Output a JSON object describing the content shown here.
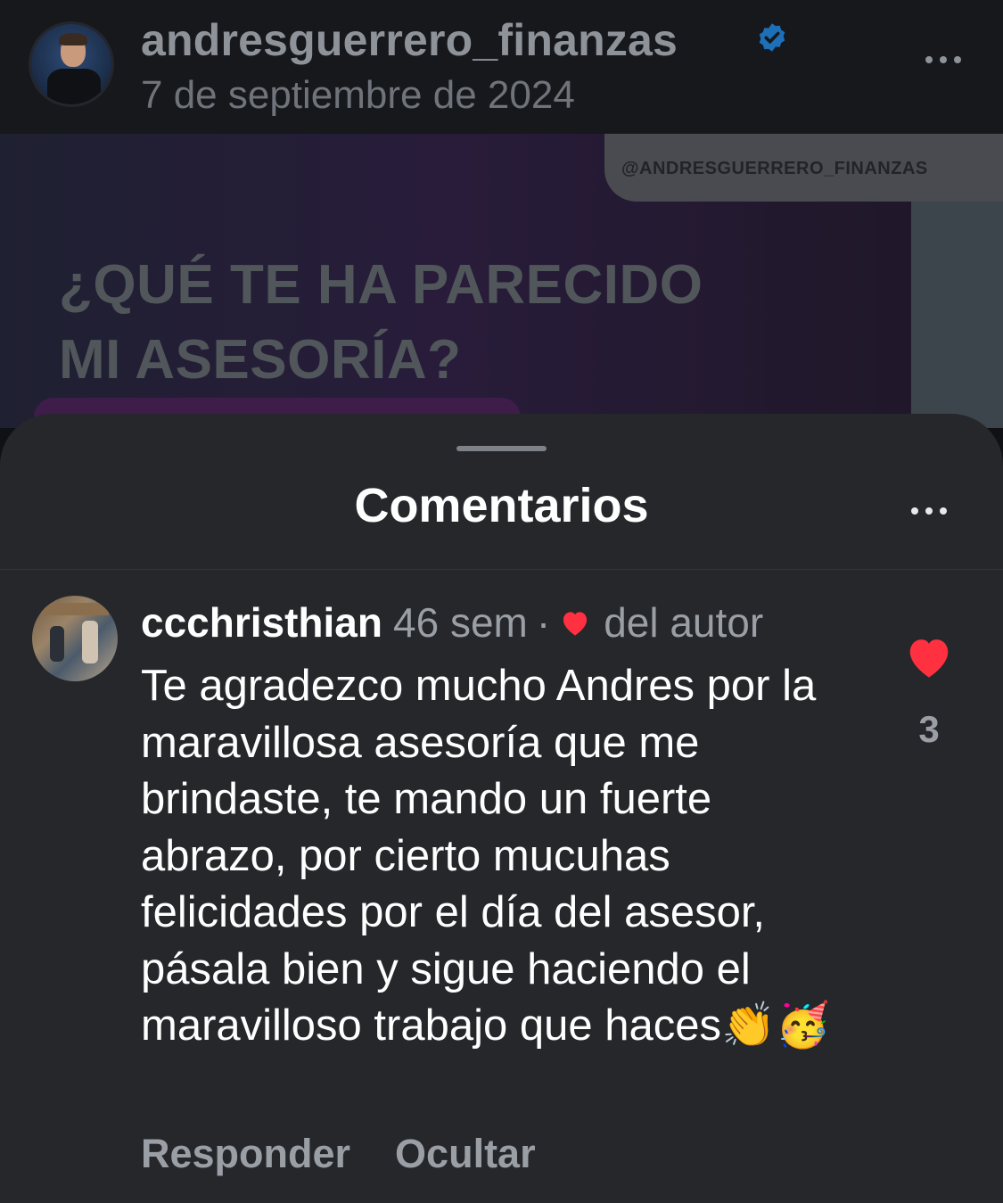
{
  "post": {
    "username": "andresguerrero_finanzas",
    "date": "7 de septiembre de 2024",
    "verified": true,
    "more_icon": "ellipsis-icon"
  },
  "post_image": {
    "handle": "@ANDRESGUERRERO_FINANZAS",
    "headline_line1": "¿QUÉ TE HA PARECIDO",
    "headline_line2": "MI ASESORÍA?"
  },
  "sheet": {
    "title": "Comentarios",
    "more_icon": "ellipsis-icon"
  },
  "comment": {
    "username": "ccchristhian",
    "time": "46 sem",
    "separator": "·",
    "liked_by_author_label": "del autor",
    "liked_by_author_icon": "heart-icon",
    "text": "Te agradezco mucho Andres por la maravillosa asesoría que me brindaste, te mando un fuerte abrazo, por cierto mucuhas felicidades por el día del asesor, pásala bien y sigue haciendo el maravilloso trabajo que haces👏🥳",
    "like_count": "3",
    "liked": true,
    "reply_label": "Responder",
    "hide_label": "Ocultar"
  },
  "colors": {
    "like_red": "#ff3040",
    "verified_blue": "#1d6fb8",
    "sheet_bg": "#25272b"
  }
}
